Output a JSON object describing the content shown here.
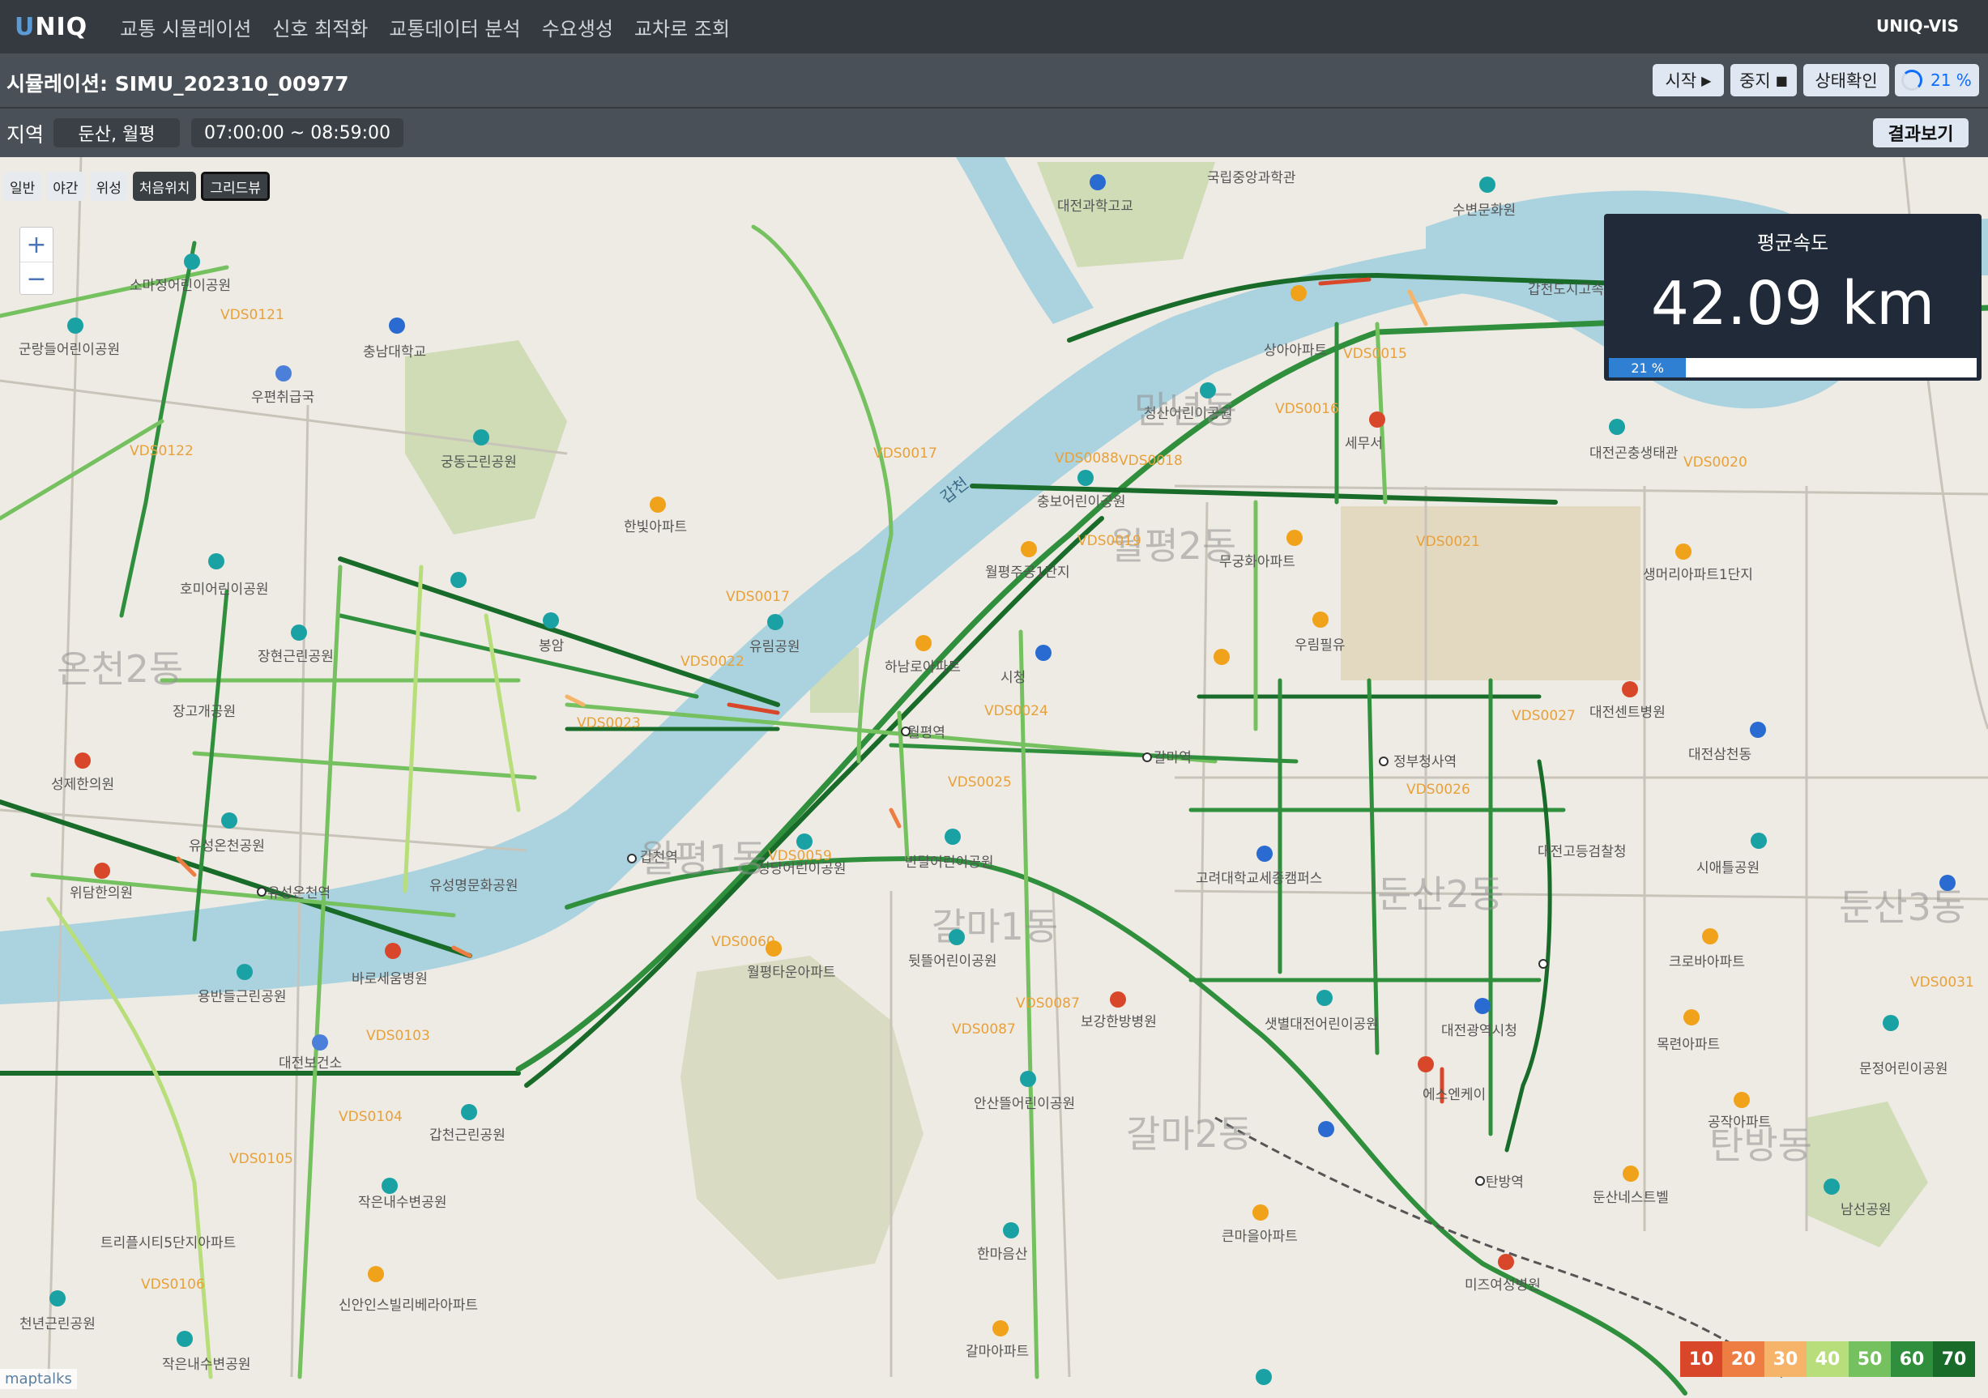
{
  "nav": {
    "brand_initial": "U",
    "brand_rest": "NIQ",
    "items": [
      "교통 시뮬레이션",
      "신호 최적화",
      "교통데이터 분석",
      "수요생성",
      "교차로 조회"
    ],
    "brand_right": "UNIQ-VIS"
  },
  "simulation": {
    "title": "시뮬레이션: SIMU_202310_00977",
    "start_label": "시작",
    "stop_label": "중지",
    "status_label": "상태확인",
    "progress_text": "21 %",
    "progress_value": 0.21
  },
  "region": {
    "label": "지역",
    "value": "둔산, 월평",
    "time_range": "07:00:00 ~ 08:59:00",
    "result_label": "결과보기"
  },
  "map_controls": {
    "layers": [
      "일반",
      "야간",
      "위성",
      "처음위치",
      "그리드뷰"
    ],
    "active_layer": "그리드뷰",
    "zoom_in": "+",
    "zoom_out": "−"
  },
  "speed_panel": {
    "title": "평균속도",
    "value": "42.09 km",
    "progress_text": "21 %"
  },
  "legend": [
    {
      "label": "10",
      "color": "#d9472b"
    },
    {
      "label": "20",
      "color": "#ee7d43"
    },
    {
      "label": "30",
      "color": "#f6b36a"
    },
    {
      "label": "40",
      "color": "#b8de7b"
    },
    {
      "label": "50",
      "color": "#75c05f"
    },
    {
      "label": "60",
      "color": "#2f8f3c"
    },
    {
      "label": "70",
      "color": "#196b2a"
    }
  ],
  "map_labels": {
    "places": [
      "대전과학고교",
      "국립중앙과학관",
      "수변문화원",
      "갑천도시고속",
      "소마정어린이공원",
      "군랑들어린이공원",
      "충남대학교",
      "우편취급국",
      "궁동근린공원",
      "한빛아파트",
      "호미어린이공원",
      "봉암",
      "유림공원",
      "장현근린공원",
      "장고개공원",
      "성제한의원",
      "유성온천공원",
      "위담한의원",
      "유성온천역",
      "유성명문화공원",
      "바로세움병원",
      "용반들근린공원",
      "대전보건소",
      "갑천근린공원",
      "작은내수변공원",
      "트리플시티5단지아파트",
      "신안인스빌리베라아파트",
      "천년근린공원",
      "작은내수변공원",
      "상아아파트",
      "청산어린이공원",
      "세무서",
      "대전곤충생태관",
      "충보어린이공원",
      "월평주공1단지",
      "무궁화아파트",
      "생머리아파트1단지",
      "우림필유",
      "시청",
      "하남로아파트",
      "월평역",
      "갈마역",
      "정부청사역",
      "대전센트병원",
      "대전삼천동",
      "갑천역",
      "성당어린이공원",
      "반달어린이공원",
      "고려대학교세종캠퍼스",
      "대전고등검찰청",
      "시애틀공원",
      "월평타운아파트",
      "뒷뜰어린이공원",
      "보강한방병원",
      "샛별대전어린이공원",
      "대전광역시청",
      "크로바아파트",
      "목련아파트",
      "문정어린이공원",
      "안산뜰어린이공원",
      "에스엔케이",
      "탄방역",
      "공작아파트",
      "둔산네스트벨",
      "남선공원",
      "큰마을아파트",
      "한마음산",
      "미즈여성병원",
      "갈마아파트"
    ],
    "districts": [
      "온천2동",
      "월평1동",
      "월평2동",
      "만년동",
      "갈마1동",
      "갈마2동",
      "둔산2동",
      "둔산3동",
      "탄방동"
    ],
    "vds": [
      "VDS0121",
      "VDS0122",
      "VDS0017",
      "VDS0088",
      "VDS0018",
      "VDS0015",
      "VDS0016",
      "VDS0019",
      "VDS0021",
      "VDS0020",
      "VDS0017",
      "VDS0022",
      "VDS0023",
      "VDS0024",
      "VDS0025",
      "VDS0026",
      "VDS0027",
      "VDS0059",
      "VDS0060",
      "VDS0087",
      "VDS0087",
      "VDS0103",
      "VDS0104",
      "VDS0105",
      "VDS0106",
      "VDS0031"
    ],
    "rivers": [
      "갑천"
    ],
    "attribution": "maptalks"
  }
}
